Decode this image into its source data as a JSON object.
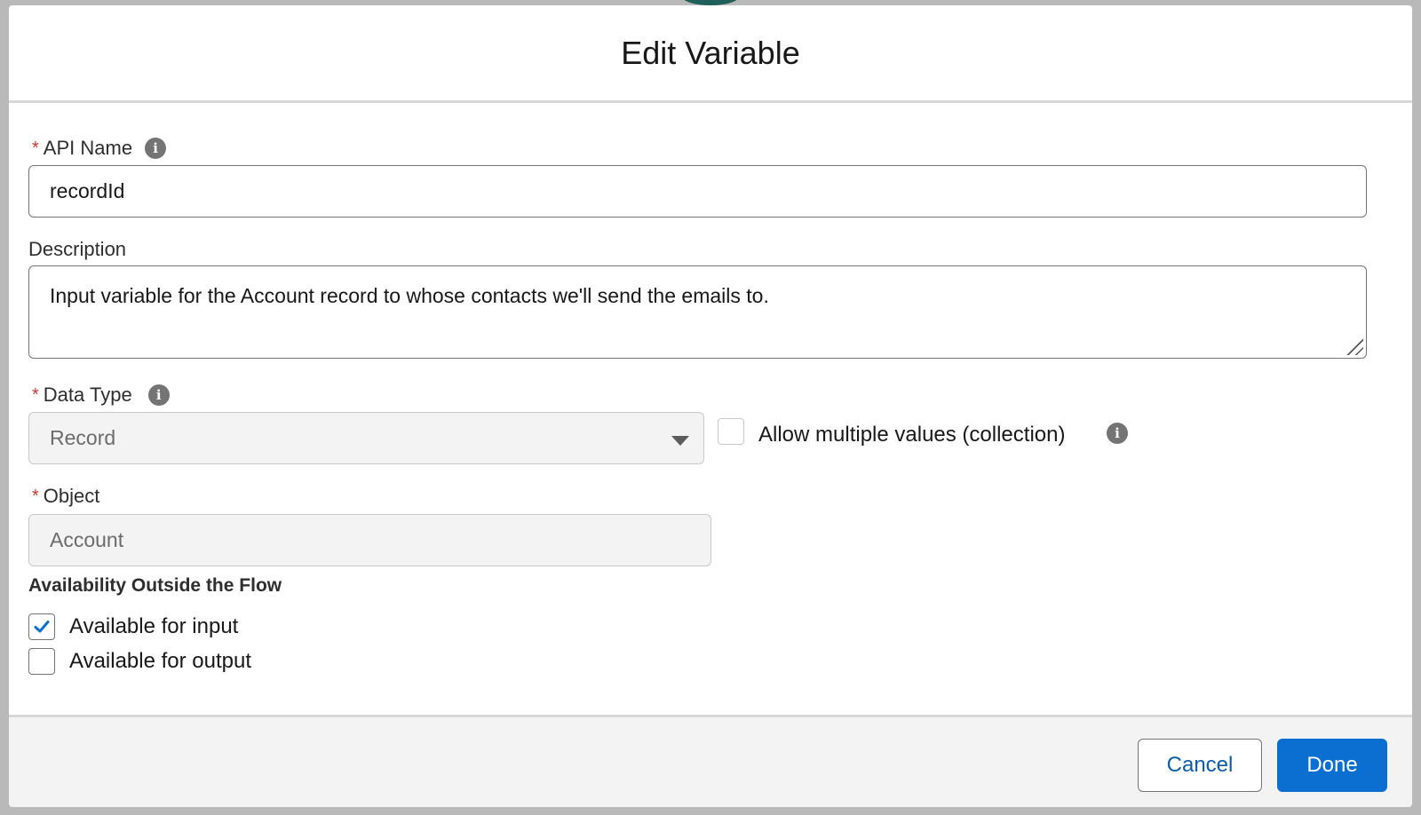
{
  "modal": {
    "title": "Edit Variable"
  },
  "fields": {
    "api_name": {
      "label": "API Name",
      "required_marker": "*",
      "value": "recordId",
      "info_icon": "info-icon"
    },
    "description": {
      "label": "Description",
      "value": "Input variable for the Account record to whose contacts we'll send the emails to."
    },
    "data_type": {
      "label": "Data Type",
      "required_marker": "*",
      "value": "Record",
      "info_icon": "info-icon"
    },
    "collection": {
      "label": "Allow multiple values (collection)",
      "checked": false,
      "info_icon": "info-icon"
    },
    "object": {
      "label": "Object",
      "required_marker": "*",
      "value": "Account"
    }
  },
  "availability": {
    "heading": "Availability Outside the Flow",
    "input": {
      "label": "Available for input",
      "checked": true
    },
    "output": {
      "label": "Available for output",
      "checked": false
    }
  },
  "footer": {
    "cancel_label": "Cancel",
    "done_label": "Done"
  },
  "colors": {
    "brand": "#0b6fd1",
    "required": "#c23934",
    "info_icon": "#747474"
  }
}
